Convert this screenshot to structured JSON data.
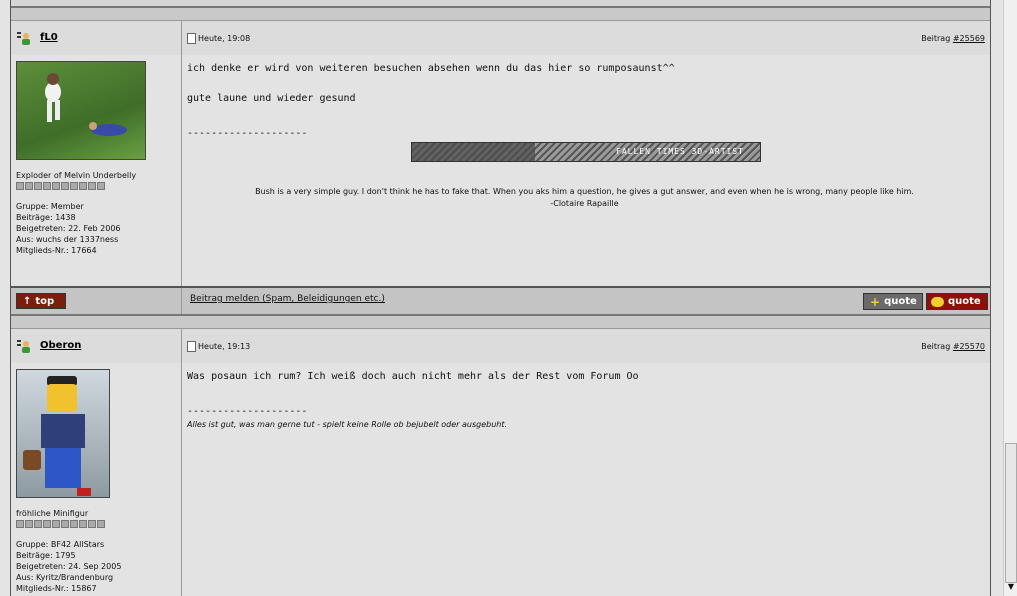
{
  "posts": [
    {
      "username": "fL0",
      "date": "Heute, 19:08",
      "beitrag_label": "Beitrag",
      "post_number": "#25569",
      "rank": "Exploder of Melvin Underbelly",
      "group": "Gruppe: Member",
      "posts_count": "Beiträge: 1438",
      "joined": "Beigetreten: 22. Feb 2006",
      "from": "Aus: wuchs der 1337ness",
      "member_no": "Mitglieds-Nr.: 17664",
      "text_line1": "ich denke er wird von weiteren besuchen absehen wenn du das hier so rumposaunst^^",
      "text_line2": "gute laune und wieder gesund",
      "sig_dashes": "--------------------",
      "banner_text": "FALLEN TIMES 3D-ARTIST",
      "sig_quote": "Bush is a very simple guy. I don't think he has to fake that. When you aks him a question, he gives a gut answer, and even when he is wrong, many people like him.",
      "sig_author": "-Clotaire Rapaille"
    },
    {
      "username": "Oberon",
      "date": "Heute, 19:13",
      "beitrag_label": "Beitrag",
      "post_number": "#25570",
      "rank": "fröhliche Minifigur",
      "group": "Gruppe: BF42 AllStars",
      "posts_count": "Beiträge: 1795",
      "joined": "Beigetreten: 24. Sep 2005",
      "from": "Aus: Kyritz/Brandenburg",
      "member_no": "Mitglieds-Nr.: 15867",
      "text_line1": "Was posaun ich rum? Ich weiß doch auch nicht mehr als der Rest vom Forum Oo",
      "sig_dashes": "--------------------",
      "sig_text": "Alles ist gut, was man gerne tut - spielt keine Rolle ob bejubelt oder ausgebuht."
    }
  ],
  "footer": {
    "top_label": "top",
    "report_label": "Beitrag melden (Spam, Beleidigungen etc.)",
    "quote_add_label": "quote",
    "quote_label": "quote"
  },
  "colors": {
    "top_button": "#7a1e0e",
    "quote_button": "#8a1208"
  }
}
